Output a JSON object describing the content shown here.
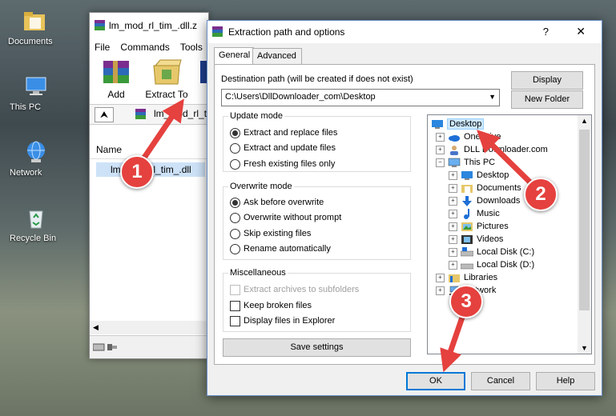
{
  "desktop": {
    "icons": [
      {
        "label": "Documents",
        "icon": "folder-icon"
      },
      {
        "label": "This PC",
        "icon": "computer-icon"
      },
      {
        "label": "Network",
        "icon": "network-icon"
      },
      {
        "label": "Recycle Bin",
        "icon": "recycle-bin-icon"
      }
    ]
  },
  "winrar": {
    "title": "lm_mod_rl_tim_.dll.z",
    "menu": [
      "File",
      "Commands",
      "Tools"
    ],
    "toolbar": {
      "add": "Add",
      "extract_to": "Extract To"
    },
    "address": "lm_mod_rl_tim",
    "column_name": "Name",
    "file": "lm_mod_rl_tim_.dll"
  },
  "dialog": {
    "title": "Extraction path and options",
    "help_glyph": "?",
    "close_glyph": "✕",
    "tabs": [
      "General",
      "Advanced"
    ],
    "destination_label": "Destination path (will be created if does not exist)",
    "destination_value": "C:\\Users\\DllDownloader_com\\Desktop",
    "display_button": "Display",
    "new_folder_button": "New Folder",
    "update_mode": {
      "title": "Update mode",
      "options": [
        "Extract and replace files",
        "Extract and update files",
        "Fresh existing files only"
      ],
      "selected": 0
    },
    "overwrite_mode": {
      "title": "Overwrite mode",
      "options": [
        "Ask before overwrite",
        "Overwrite without prompt",
        "Skip existing files",
        "Rename automatically"
      ],
      "selected": 0
    },
    "misc": {
      "title": "Miscellaneous",
      "options": [
        "Extract archives to subfolders",
        "Keep broken files",
        "Display files in Explorer"
      ]
    },
    "save_settings": "Save settings",
    "tree": {
      "items": [
        "Desktop",
        "OneDrive",
        "DLL Downloader.com",
        "This PC",
        "Desktop",
        "Documents",
        "Downloads",
        "Music",
        "Pictures",
        "Videos",
        "Local Disk (C:)",
        "Local Disk (D:)",
        "Libraries",
        "Network"
      ]
    },
    "ok": "OK",
    "cancel": "Cancel",
    "help": "Help"
  },
  "annotations": [
    "1",
    "2",
    "3"
  ],
  "colors": {
    "annotation_red": "#e5413e",
    "selection": "#cce8ff",
    "accent": "#0078d7"
  }
}
